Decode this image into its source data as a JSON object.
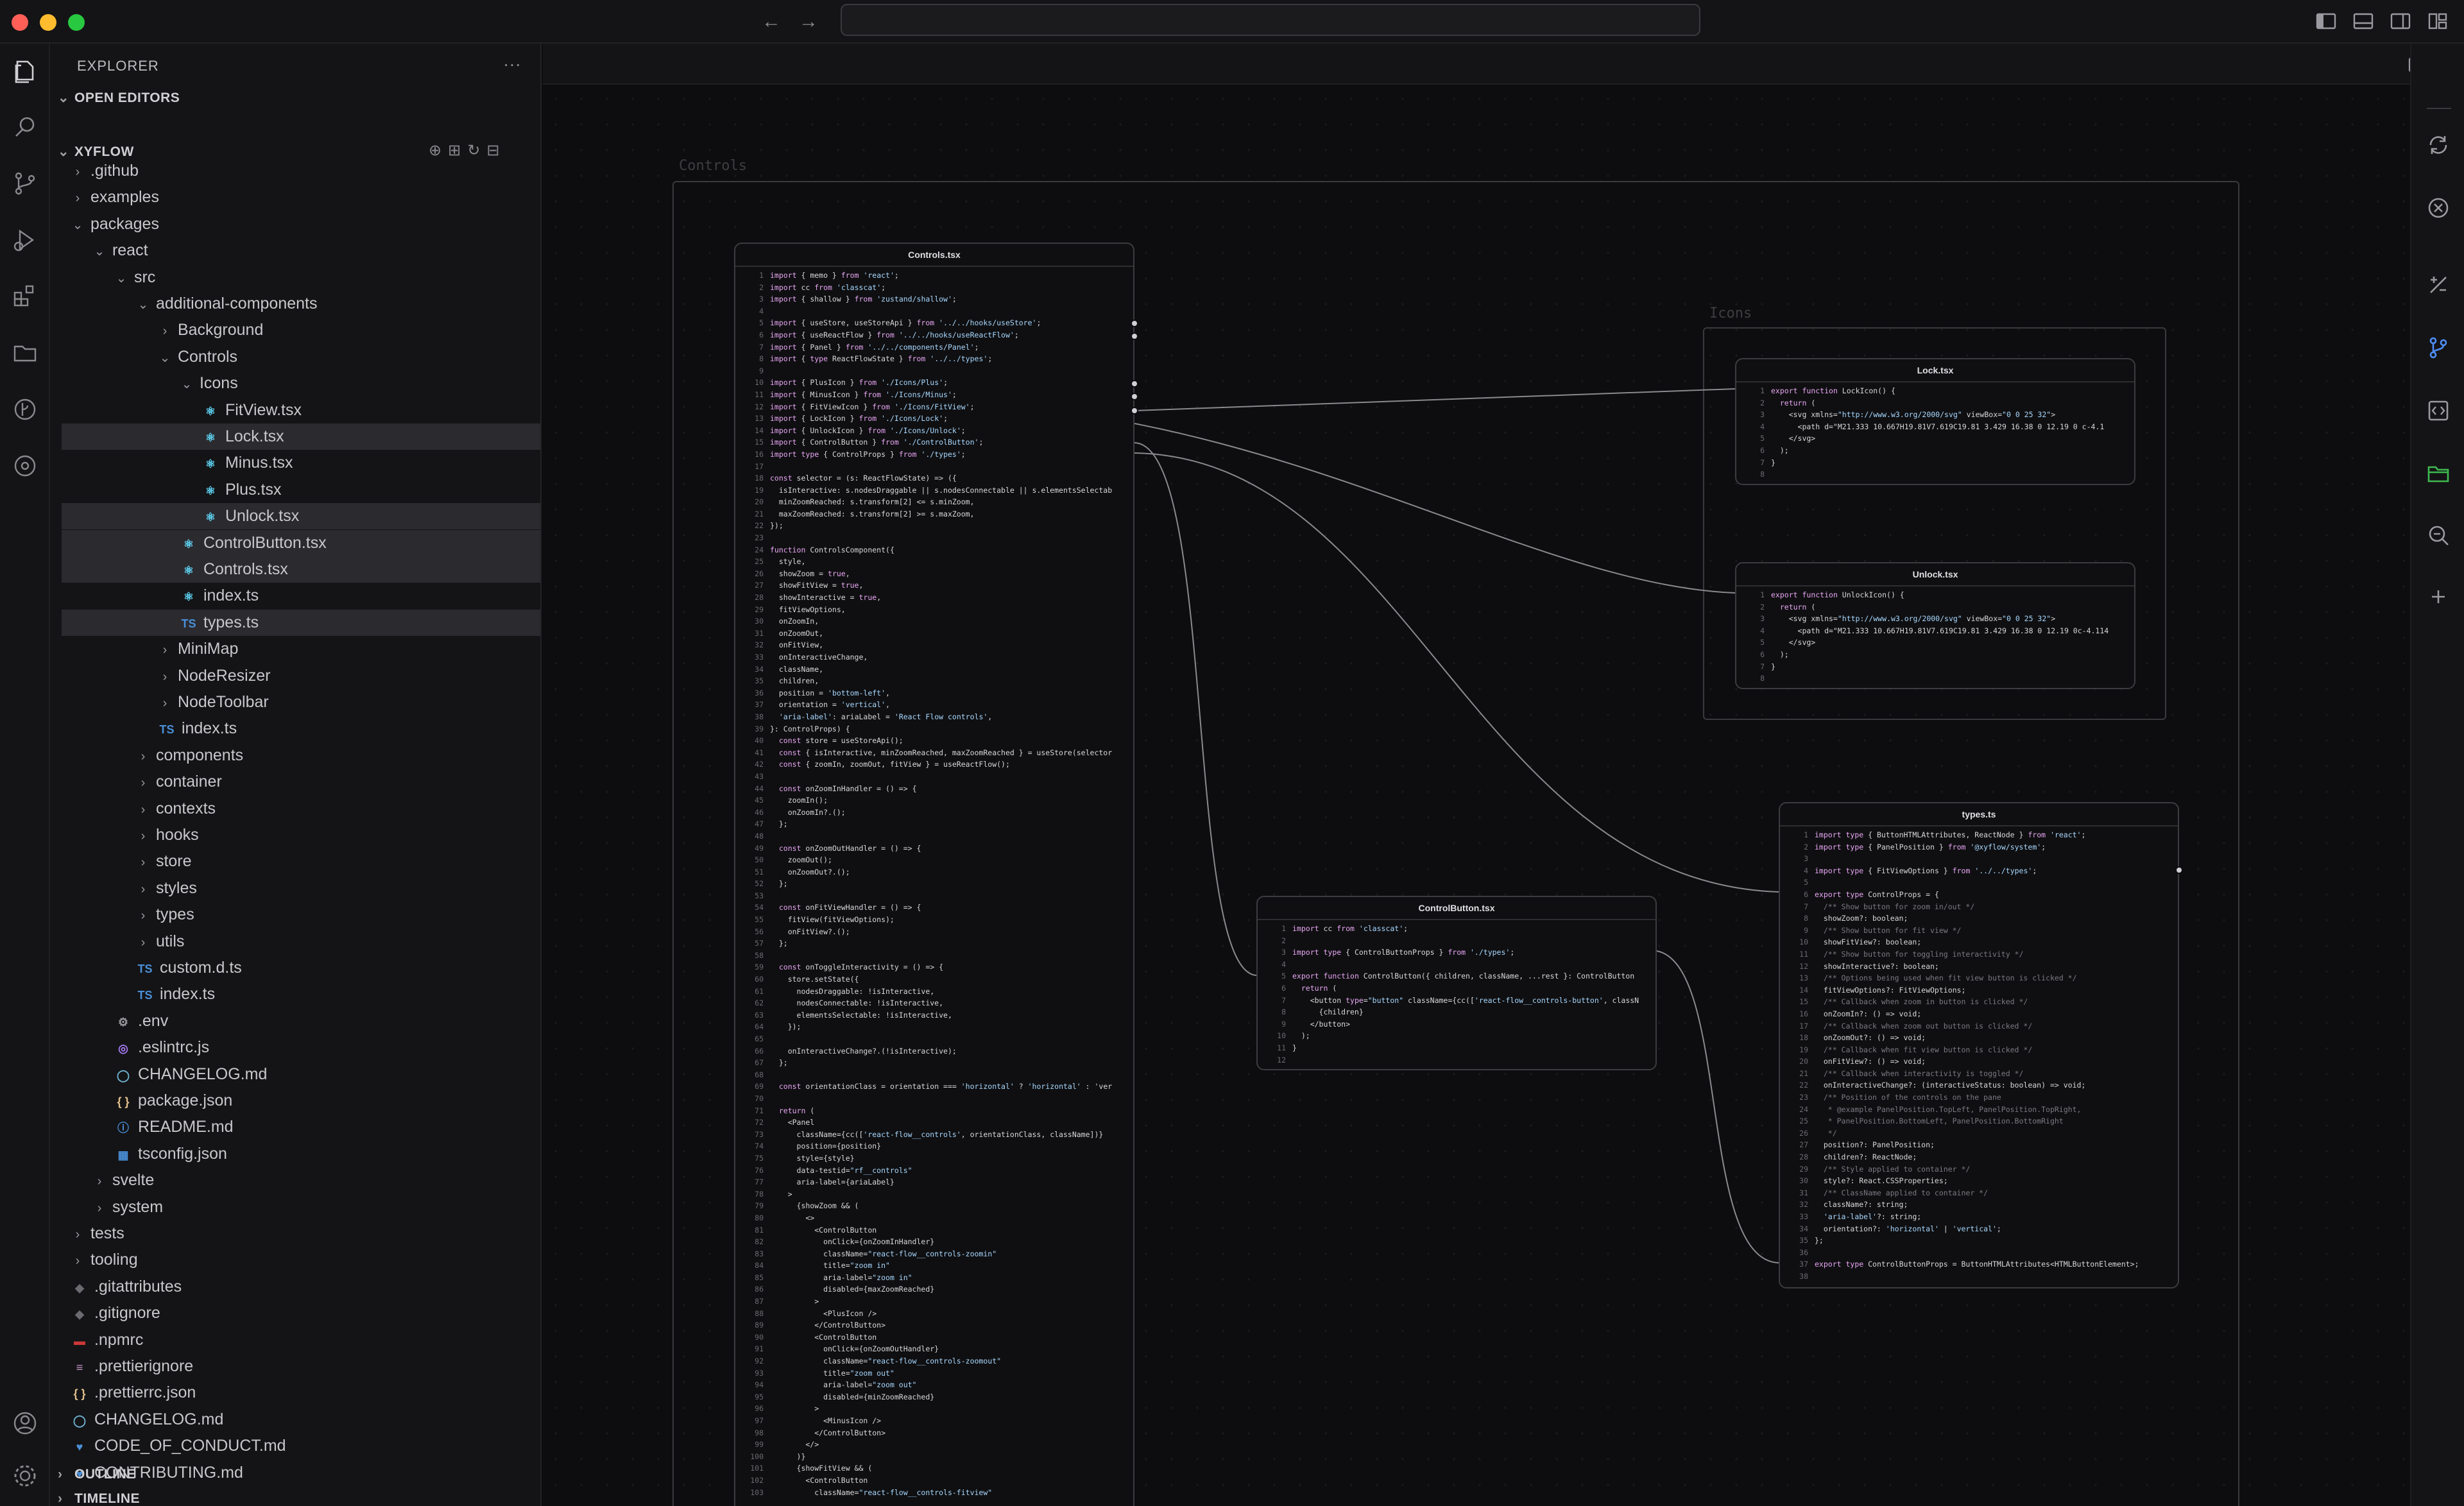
{
  "explorer": {
    "title": "EXPLORER",
    "more": "···",
    "open_editors": "OPEN EDITORS",
    "workspace": "XYFLOW",
    "outline": "OUTLINE",
    "timeline": "TIMELINE",
    "tree": [
      {
        "label": ".github",
        "depth": 0,
        "type": "folder",
        "open": false
      },
      {
        "label": "examples",
        "depth": 0,
        "type": "folder",
        "open": false
      },
      {
        "label": "packages",
        "depth": 0,
        "type": "folder",
        "open": true
      },
      {
        "label": "react",
        "depth": 1,
        "type": "folder",
        "open": true
      },
      {
        "label": "src",
        "depth": 2,
        "type": "folder",
        "open": true
      },
      {
        "label": "additional-components",
        "depth": 3,
        "type": "folder",
        "open": true
      },
      {
        "label": "Background",
        "depth": 4,
        "type": "folder",
        "open": false
      },
      {
        "label": "Controls",
        "depth": 4,
        "type": "folder",
        "open": true
      },
      {
        "label": "Icons",
        "depth": 5,
        "type": "folder",
        "open": true
      },
      {
        "label": "FitView.tsx",
        "depth": 6,
        "type": "tsx"
      },
      {
        "label": "Lock.tsx",
        "depth": 6,
        "type": "tsx",
        "selected": true
      },
      {
        "label": "Minus.tsx",
        "depth": 6,
        "type": "tsx"
      },
      {
        "label": "Plus.tsx",
        "depth": 6,
        "type": "tsx"
      },
      {
        "label": "Unlock.tsx",
        "depth": 6,
        "type": "tsx",
        "selected": true
      },
      {
        "label": "ControlButton.tsx",
        "depth": 5,
        "type": "tsx",
        "selected": true
      },
      {
        "label": "Controls.tsx",
        "depth": 5,
        "type": "tsx",
        "selected": true
      },
      {
        "label": "index.ts",
        "depth": 5,
        "type": "tsx"
      },
      {
        "label": "types.ts",
        "depth": 5,
        "type": "ts",
        "selected": true
      },
      {
        "label": "MiniMap",
        "depth": 4,
        "type": "folder",
        "open": false
      },
      {
        "label": "NodeResizer",
        "depth": 4,
        "type": "folder",
        "open": false
      },
      {
        "label": "NodeToolbar",
        "depth": 4,
        "type": "folder",
        "open": false
      },
      {
        "label": "index.ts",
        "depth": 4,
        "type": "ts"
      },
      {
        "label": "components",
        "depth": 3,
        "type": "folder",
        "open": false
      },
      {
        "label": "container",
        "depth": 3,
        "type": "folder",
        "open": false
      },
      {
        "label": "contexts",
        "depth": 3,
        "type": "folder",
        "open": false
      },
      {
        "label": "hooks",
        "depth": 3,
        "type": "folder",
        "open": false
      },
      {
        "label": "store",
        "depth": 3,
        "type": "folder",
        "open": false
      },
      {
        "label": "styles",
        "depth": 3,
        "type": "folder",
        "open": false
      },
      {
        "label": "types",
        "depth": 3,
        "type": "folder",
        "open": false
      },
      {
        "label": "utils",
        "depth": 3,
        "type": "folder",
        "open": false
      },
      {
        "label": "custom.d.ts",
        "depth": 3,
        "type": "ts"
      },
      {
        "label": "index.ts",
        "depth": 3,
        "type": "ts"
      },
      {
        "label": ".env",
        "depth": 2,
        "type": "gear"
      },
      {
        "label": ".eslintrc.js",
        "depth": 2,
        "type": "eslint"
      },
      {
        "label": "CHANGELOG.md",
        "depth": 2,
        "type": "md"
      },
      {
        "label": "package.json",
        "depth": 2,
        "type": "json"
      },
      {
        "label": "README.md",
        "depth": 2,
        "type": "info"
      },
      {
        "label": "tsconfig.json",
        "depth": 2,
        "type": "tsconfig"
      },
      {
        "label": "svelte",
        "depth": 1,
        "type": "folder",
        "open": false
      },
      {
        "label": "system",
        "depth": 1,
        "type": "folder",
        "open": false
      },
      {
        "label": "tests",
        "depth": 0,
        "type": "folder",
        "open": false
      },
      {
        "label": "tooling",
        "depth": 0,
        "type": "folder",
        "open": false
      },
      {
        "label": ".gitattributes",
        "depth": 0,
        "type": "git"
      },
      {
        "label": ".gitignore",
        "depth": 0,
        "type": "git"
      },
      {
        "label": ".npmrc",
        "depth": 0,
        "type": "npm"
      },
      {
        "label": ".prettierignore",
        "depth": 0,
        "type": "prettier"
      },
      {
        "label": ".prettierrc.json",
        "depth": 0,
        "type": "json"
      },
      {
        "label": "CHANGELOG.md",
        "depth": 0,
        "type": "md"
      },
      {
        "label": "CODE_OF_CONDUCT.md",
        "depth": 0,
        "type": "conduct"
      },
      {
        "label": "CONTRIBUTING.md",
        "depth": 0,
        "type": "conduct"
      }
    ]
  },
  "icons": {
    "ts_glyph": "TS",
    "react_glyph": "⚛",
    "json_glyph": "{ }",
    "info_glyph": "ⓘ",
    "md_glyph": "◯",
    "eslint_glyph": "◎",
    "gear_glyph": "⚙",
    "git_glyph": "◆",
    "npm_glyph": "▬",
    "prettier_glyph": "≡",
    "conduct_glyph": "♥",
    "tsconfig_glyph": "▦"
  },
  "canvas": {
    "groups": {
      "controls": "Controls",
      "icons": "Icons"
    },
    "files": {
      "controls": {
        "title": "Controls.tsx",
        "start": 1,
        "lines": [
          "import { memo } from 'react';",
          "import cc from 'classcat';",
          "import { shallow } from 'zustand/shallow';",
          "",
          "import { useStore, useStoreApi } from '../../hooks/useStore';",
          "import { useReactFlow } from '../../hooks/useReactFlow';",
          "import { Panel } from '../../components/Panel';",
          "import { type ReactFlowState } from '../../types';",
          "",
          "import { PlusIcon } from './Icons/Plus';",
          "import { MinusIcon } from './Icons/Minus';",
          "import { FitViewIcon } from './Icons/FitView';",
          "import { LockIcon } from './Icons/Lock';",
          "import { UnlockIcon } from './Icons/Unlock';",
          "import { ControlButton } from './ControlButton';",
          "import type { ControlProps } from './types';",
          "",
          "const selector = (s: ReactFlowState) => ({",
          "  isInteractive: s.nodesDraggable || s.nodesConnectable || s.elementsSelectab",
          "  minZoomReached: s.transform[2] <= s.minZoom,",
          "  maxZoomReached: s.transform[2] >= s.maxZoom,",
          "});",
          "",
          "function ControlsComponent({",
          "  style,",
          "  showZoom = true,",
          "  showFitView = true,",
          "  showInteractive = true,",
          "  fitViewOptions,",
          "  onZoomIn,",
          "  onZoomOut,",
          "  onFitView,",
          "  onInteractiveChange,",
          "  className,",
          "  children,",
          "  position = 'bottom-left',",
          "  orientation = 'vertical',",
          "  'aria-label': ariaLabel = 'React Flow controls',",
          "}: ControlProps) {",
          "  const store = useStoreApi();",
          "  const { isInteractive, minZoomReached, maxZoomReached } = useStore(selector",
          "  const { zoomIn, zoomOut, fitView } = useReactFlow();",
          "",
          "  const onZoomInHandler = () => {",
          "    zoomIn();",
          "    onZoomIn?.();",
          "  };",
          "",
          "  const onZoomOutHandler = () => {",
          "    zoomOut();",
          "    onZoomOut?.();",
          "  };",
          "",
          "  const onFitViewHandler = () => {",
          "    fitView(fitViewOptions);",
          "    onFitView?.();",
          "  };",
          "",
          "  const onToggleInteractivity = () => {",
          "    store.setState({",
          "      nodesDraggable: !isInteractive,",
          "      nodesConnectable: !isInteractive,",
          "      elementsSelectable: !isInteractive,",
          "    });",
          "",
          "    onInteractiveChange?.(!isInteractive);",
          "  };",
          "",
          "  const orientationClass = orientation === 'horizontal' ? 'horizontal' : 'ver",
          "",
          "  return (",
          "    <Panel",
          "      className={cc(['react-flow__controls', orientationClass, className])}",
          "      position={position}",
          "      style={style}",
          "      data-testid=\"rf__controls\"",
          "      aria-label={ariaLabel}",
          "    >",
          "      {showZoom && (",
          "        <>",
          "          <ControlButton",
          "            onClick={onZoomInHandler}",
          "            className=\"react-flow__controls-zoomin\"",
          "            title=\"zoom in\"",
          "            aria-label=\"zoom in\"",
          "            disabled={maxZoomReached}",
          "          >",
          "            <PlusIcon />",
          "          </ControlButton>",
          "          <ControlButton",
          "            onClick={onZoomOutHandler}",
          "            className=\"react-flow__controls-zoomout\"",
          "            title=\"zoom out\"",
          "            aria-label=\"zoom out\"",
          "            disabled={minZoomReached}",
          "          >",
          "            <MinusIcon />",
          "          </ControlButton>",
          "        </>",
          "      )}",
          "      {showFitView && (",
          "        <ControlButton",
          "          className=\"react-flow__controls-fitview\""
        ]
      },
      "lock": {
        "title": "Lock.tsx",
        "start": 1,
        "lines": [
          "export function LockIcon() {",
          "  return (",
          "    <svg xmlns=\"http://www.w3.org/2000/svg\" viewBox=\"0 0 25 32\">",
          "      <path d=\"M21.333 10.667H19.81V7.619C19.81 3.429 16.38 0 12.19 0 c-4.1",
          "    </svg>",
          "  );",
          "}",
          ""
        ]
      },
      "unlock": {
        "title": "Unlock.tsx",
        "start": 1,
        "lines": [
          "export function UnlockIcon() {",
          "  return (",
          "    <svg xmlns=\"http://www.w3.org/2000/svg\" viewBox=\"0 0 25 32\">",
          "      <path d=\"M21.333 10.667H19.81V7.619C19.81 3.429 16.38 0 12.19 0c-4.114",
          "    </svg>",
          "  );",
          "}",
          ""
        ]
      },
      "controlbutton": {
        "title": "ControlButton.tsx",
        "start": 1,
        "lines": [
          "import cc from 'classcat';",
          "",
          "import type { ControlButtonProps } from './types';",
          "",
          "export function ControlButton({ children, className, ...rest }: ControlButton",
          "  return (",
          "    <button type=\"button\" className={cc(['react-flow__controls-button', classN",
          "      {children}",
          "    </button>",
          "  );",
          "}",
          ""
        ]
      },
      "types": {
        "title": "types.ts",
        "start": 1,
        "lines": [
          "import type { ButtonHTMLAttributes, ReactNode } from 'react';",
          "import type { PanelPosition } from '@xyflow/system';",
          "",
          "import type { FitViewOptions } from '../../types';",
          "",
          "export type ControlProps = {",
          "  /** Show button for zoom in/out */",
          "  showZoom?: boolean;",
          "  /** Show button for fit view */",
          "  showFitView?: boolean;",
          "  /** Show button for toggling interactivity */",
          "  showInteractive?: boolean;",
          "  /** Options being used when fit view button is clicked */",
          "  fitViewOptions?: FitViewOptions;",
          "  /** Callback when zoom in button is clicked */",
          "  onZoomIn?: () => void;",
          "  /** Callback when zoom out button is clicked */",
          "  onZoomOut?: () => void;",
          "  /** Callback when fit view button is clicked */",
          "  onFitView?: () => void;",
          "  /** Callback when interactivity is toggled */",
          "  onInteractiveChange?: (interactiveStatus: boolean) => void;",
          "  /** Position of the controls on the pane",
          "   * @example PanelPosition.TopLeft, PanelPosition.TopRight,",
          "   * PanelPosition.BottomLeft, PanelPosition.BottomRight",
          "   */",
          "  position?: PanelPosition;",
          "  children?: ReactNode;",
          "  /** Style applied to container */",
          "  style?: React.CSSProperties;",
          "  /** ClassName applied to container */",
          "  className?: string;",
          "  'aria-label'?: string;",
          "  orientation?: 'horizontal' | 'vertical';",
          "};",
          "",
          "export type ControlButtonProps = ButtonHTMLAttributes<HTMLButtonElement>;",
          ""
        ]
      }
    }
  },
  "colors": {
    "accent_green": "#3fb950",
    "traffic_red": "#ff5f57",
    "traffic_yellow": "#febc2e",
    "traffic_green": "#28c840"
  }
}
